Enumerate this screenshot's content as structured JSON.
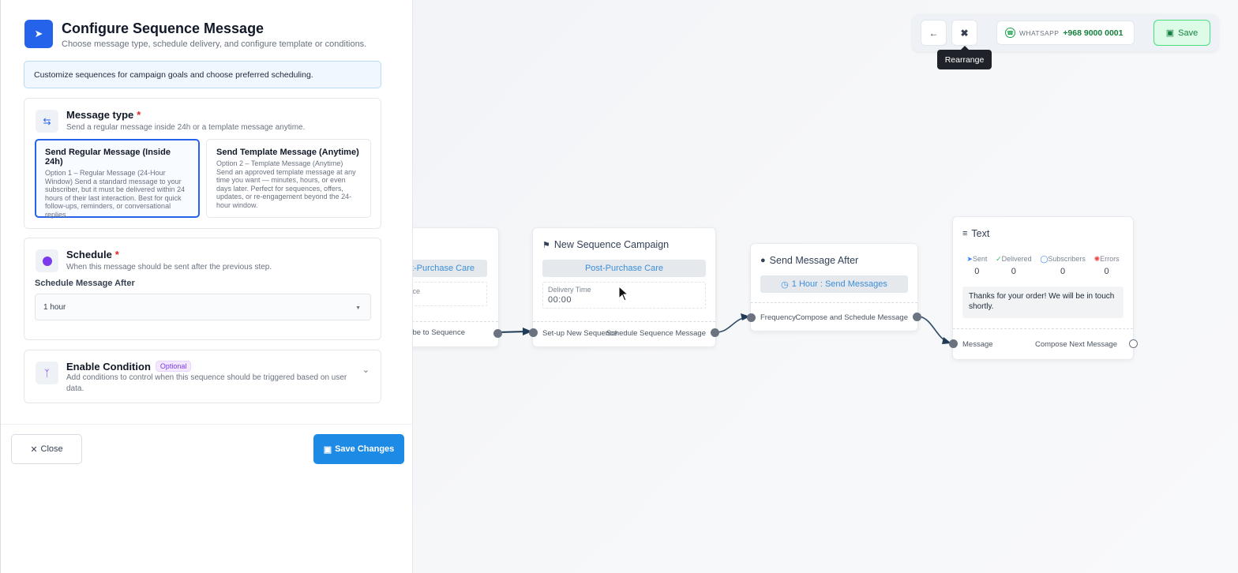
{
  "panel": {
    "title": "Configure Sequence Message",
    "subtitle": "Choose message type, schedule delivery, and configure template or conditions.",
    "banner": "Customize sequences for campaign goals and choose preferred scheduling.",
    "message_type": {
      "title": "Message type",
      "required_mark": "*",
      "subtitle": "Send a regular message inside 24h or a template message anytime.",
      "options": [
        {
          "title": "Send Regular Message (Inside 24h)",
          "description": "Option 1 – Regular Message (24-Hour Window) Send a standard message to your subscriber, but it must be delivered within 24 hours of their last interaction. Best for quick follow-ups, reminders, or conversational replies.",
          "selected": true
        },
        {
          "title": "Send Template Message (Anytime)",
          "description": "Option 2 – Template Message (Anytime) Send an approved template message at any time you want — minutes, hours, or even days later. Perfect for sequences, offers, updates, or re-engagement beyond the 24-hour window.",
          "selected": false
        }
      ]
    },
    "schedule": {
      "title": "Schedule",
      "required_mark": "*",
      "subtitle": "When this message should be sent after the previous step.",
      "field_label": "Schedule Message After",
      "selected_value": "1 hour"
    },
    "condition": {
      "title": "Enable Condition",
      "badge": "Optional",
      "subtitle": "Add conditions to control when this sequence should be triggered based on user data."
    },
    "close_label": "Close",
    "save_label": "Save Changes"
  },
  "toolbar": {
    "whatsapp_label": "WHATSAPP",
    "whatsapp_number": "+968 9000 0001",
    "save_label": "Save",
    "tooltip": "Rearrange"
  },
  "canvas": {
    "node_partial": {
      "pill": "Post-Purchase Care",
      "field_fragment": "ce",
      "port_label": "Subscribe to Sequence"
    },
    "node_campaign": {
      "title": "New Sequence Campaign",
      "pill": "Post-Purchase Care",
      "field_label": "Delivery Time",
      "field_value": "00:00",
      "port_in": "Set-up New Sequence",
      "port_out": "Schedule Sequence Message"
    },
    "node_after": {
      "title": "Send Message After",
      "pill": "1 Hour : Send Messages",
      "port_in": "Frequency",
      "port_out": "Compose and Schedule Message"
    },
    "node_text": {
      "title": "Text",
      "stats": [
        {
          "label": "Sent",
          "value": "0",
          "icon": "send-icon",
          "color": "#3b82f6"
        },
        {
          "label": "Delivered",
          "value": "0",
          "icon": "check-circle-icon",
          "color": "#22c55e"
        },
        {
          "label": "Subscribers",
          "value": "0",
          "icon": "user-circle-icon",
          "color": "#3b82f6"
        },
        {
          "label": "Errors",
          "value": "0",
          "icon": "bug-icon",
          "color": "#ef4444"
        }
      ],
      "message": "Thanks for your order! We will be in touch shortly.",
      "port_in": "Message",
      "port_out": "Compose Next Message"
    }
  },
  "colors": {
    "primary": "#2563eb",
    "save_button": "#1d8ae6",
    "whatsapp_green": "#16a34a",
    "pill_text": "#3b8ed8",
    "required": "#dc2626"
  }
}
